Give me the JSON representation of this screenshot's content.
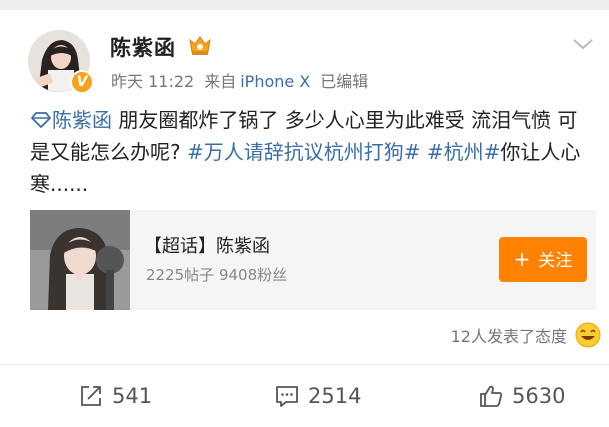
{
  "post": {
    "username": "陈紫函",
    "time": "昨天 11:22",
    "source_prefix": "来自",
    "source": "iPhone X",
    "edited": "已编辑",
    "content": {
      "mention": "陈紫函",
      "text1": " 朋友圈都炸了锅了 多少人心里为此难受 流泪气愤 可是又能怎么办呢? ",
      "hashtag1": "#万人请辞抗议杭州打狗#",
      "space": " ",
      "hashtag2": "#杭州#",
      "text2": "你让人心寒......"
    },
    "card": {
      "title": "【超话】陈紫函",
      "stats": "2225帖子 9408粉丝",
      "follow_plus": "+",
      "follow_label": "关注"
    },
    "reaction_text": "12人发表了态度",
    "actions": {
      "repost_count": "541",
      "comment_count": "2514",
      "like_count": "5630"
    }
  },
  "colors": {
    "accent": "#ff8200",
    "link": "#3a6ea8",
    "verify": "#f7a21b"
  },
  "icons": {
    "verify": "verified-v-icon",
    "vip": "vip-crown-icon",
    "menu": "chevron-down-icon",
    "mention": "diamond-mention-icon",
    "repost": "repost-icon",
    "comment": "comment-icon",
    "like": "thumbs-up-icon",
    "reaction": "laughing-emoji-icon"
  }
}
